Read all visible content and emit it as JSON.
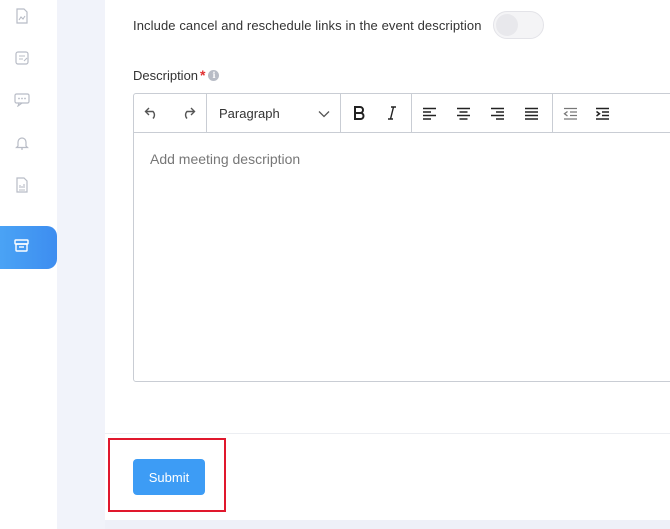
{
  "sidebar": {
    "items": [
      {
        "icon": "chart-doc-icon"
      },
      {
        "icon": "form-doc-icon"
      },
      {
        "icon": "chat-icon"
      },
      {
        "icon": "bell-icon"
      },
      {
        "icon": "report-doc-icon"
      },
      {
        "icon": "archive-icon",
        "active": true
      }
    ]
  },
  "form": {
    "toggle_label": "Include cancel and reschedule links in the event description",
    "description_label": "Description",
    "required_mark": "*",
    "info_glyph": "i",
    "editor": {
      "paragraph_label": "Paragraph",
      "placeholder": "Add meeting description",
      "toolbar": [
        "undo-icon",
        "redo-icon",
        "bold-icon",
        "italic-icon",
        "align-left-icon",
        "align-center-icon",
        "align-right-icon",
        "align-justify-icon",
        "outdent-icon",
        "indent-icon"
      ]
    },
    "submit_label": "Submit"
  },
  "colors": {
    "accent": "#3d9cf5",
    "highlight": "#e0182d",
    "required": "#e03131"
  }
}
